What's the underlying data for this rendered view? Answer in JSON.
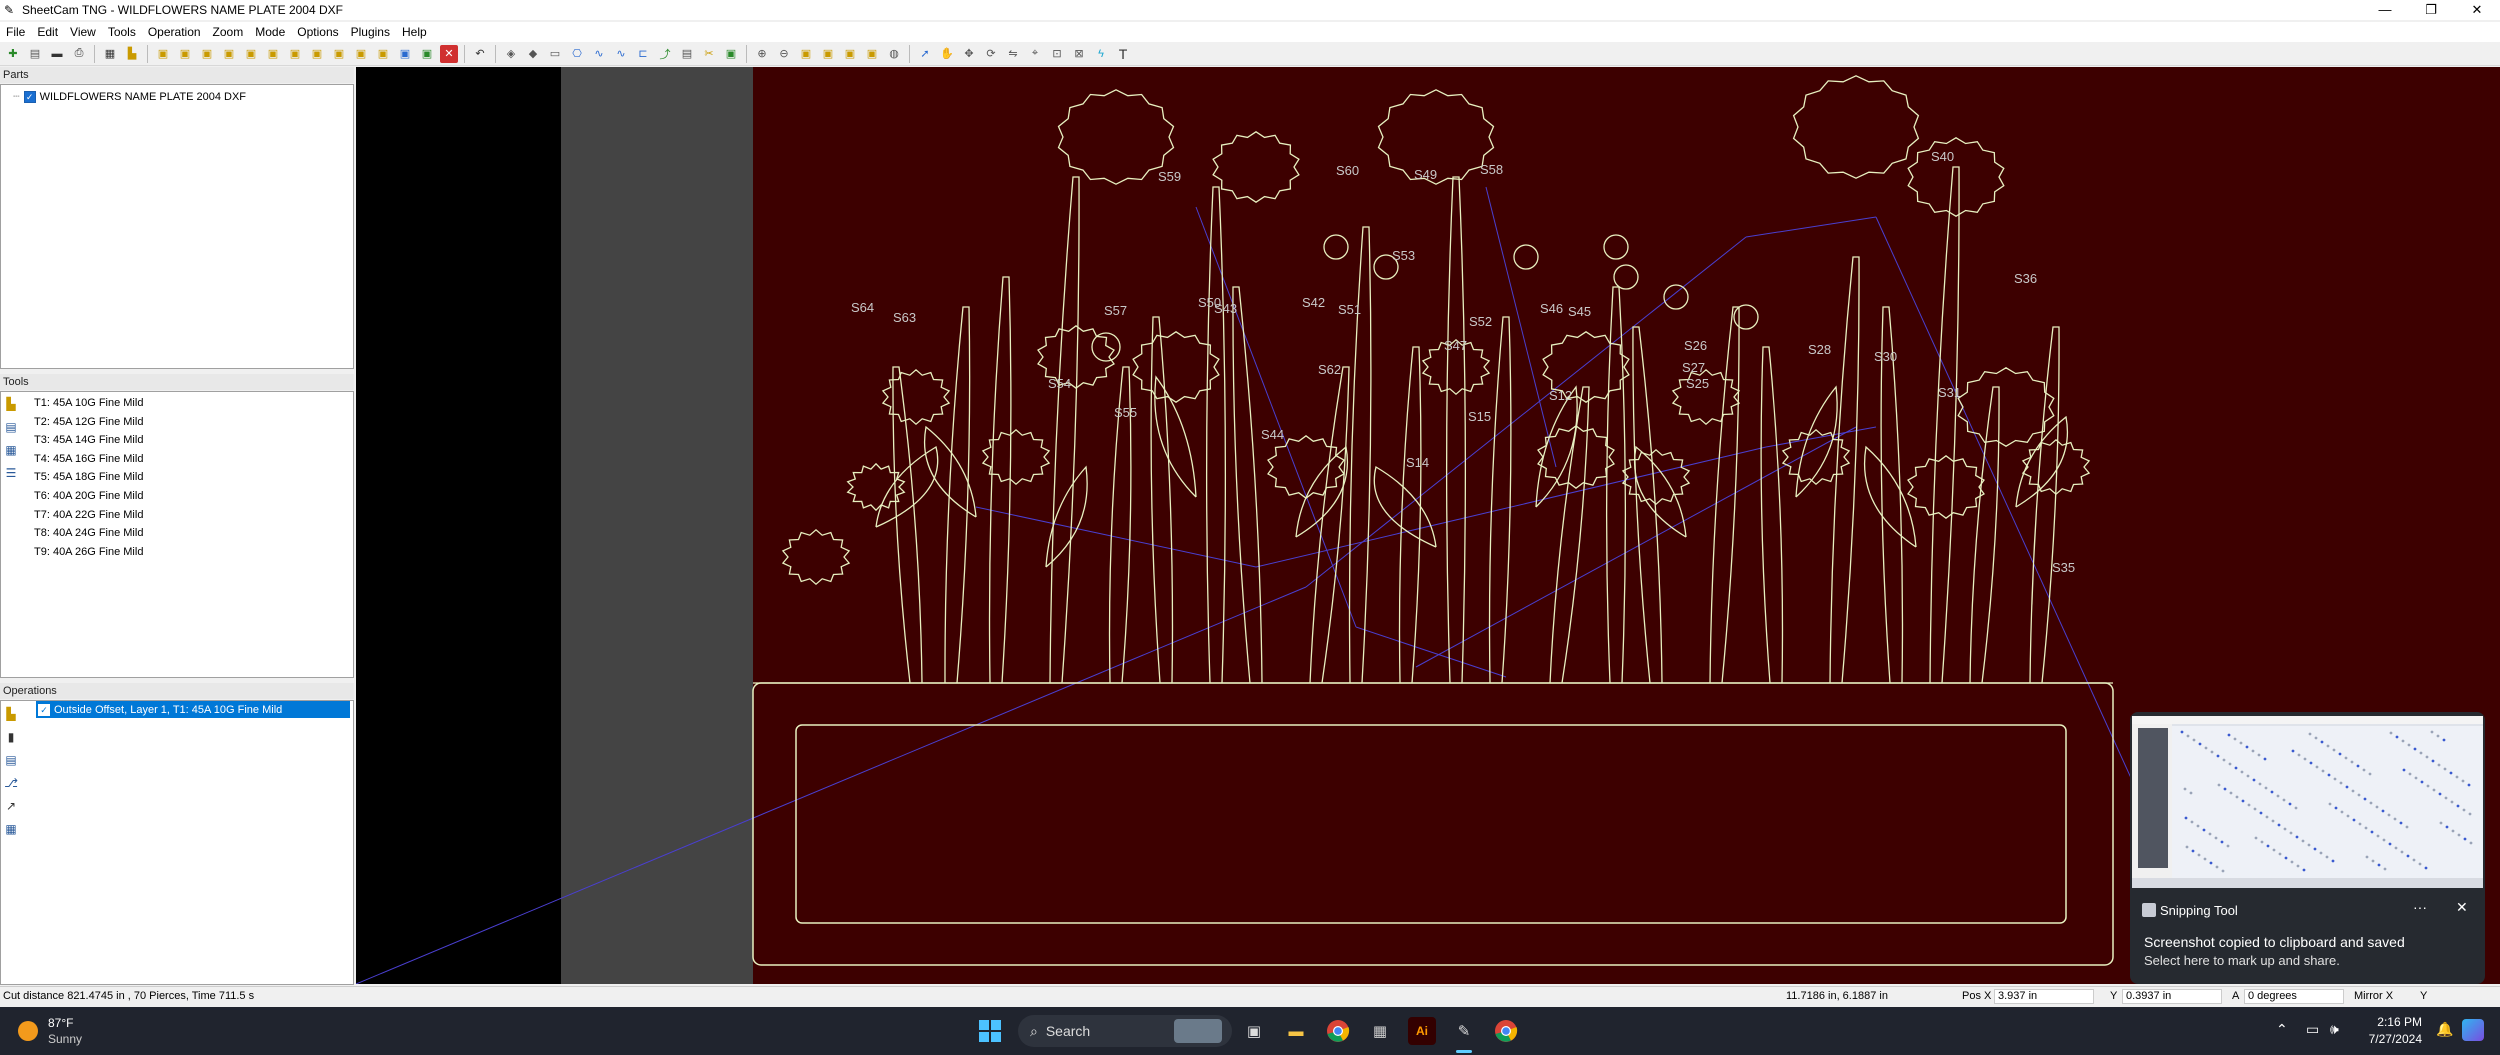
{
  "window": {
    "title": "SheetCam TNG - WILDFLOWERS NAME PLATE 2004 DXF",
    "controls": [
      "—",
      "❐",
      "✕"
    ]
  },
  "menu": [
    "File",
    "Edit",
    "View",
    "Tools",
    "Operation",
    "Zoom",
    "Mode",
    "Options",
    "Plugins",
    "Help"
  ],
  "panels": {
    "parts": {
      "header": "Parts",
      "items": [
        {
          "label": "WILDFLOWERS NAME PLATE 2004 DXF",
          "checked": true
        }
      ]
    },
    "tools": {
      "header": "Tools",
      "items": [
        "T1: 45A 10G Fine Mild",
        "T2: 45A 12G Fine Mild",
        "T3: 45A 14G Fine Mild",
        "T4: 45A 16G Fine Mild",
        "T5: 45A 18G Fine Mild",
        "T6: 40A 20G Fine Mild",
        "T7: 40A 22G Fine Mild",
        "T8: 40A 24G Fine Mild",
        "T9: 40A 26G Fine Mild"
      ]
    },
    "operations": {
      "header": "Operations",
      "items": [
        {
          "label": "Outside Offset, Layer 1, T1: 45A 10G Fine Mild",
          "checked": true,
          "selected": true
        }
      ]
    }
  },
  "viewport": {
    "background": "#3d0000",
    "outline_color": "#e8f0c0",
    "rapid_color": "#4a3fd0",
    "labels": [
      "S60",
      "S59",
      "S58",
      "S49",
      "S40",
      "S36",
      "S64",
      "S63",
      "S57",
      "S50",
      "S42",
      "S43",
      "S51",
      "S53",
      "S52",
      "S46",
      "S47",
      "S45",
      "S55",
      "S54",
      "S44",
      "S62",
      "S15",
      "S12",
      "S27",
      "S26",
      "S25",
      "S28",
      "S30",
      "S31",
      "S35",
      "S14"
    ]
  },
  "status": {
    "summary": "Cut distance 821.4745 in , 70 Pierces, Time 711.5 s",
    "cursor": "11.7186 in, 6.1887 in",
    "pos_x_label": "Pos X",
    "pos_x_value": "3.937 in",
    "y_label": "Y",
    "y_value": "0.3937 in",
    "angle_label": "A",
    "angle_value": "0 degrees",
    "mirror": "Mirror X",
    "mirror_y": "Y"
  },
  "toast": {
    "app": "Snipping Tool",
    "message": "Screenshot copied to clipboard and saved",
    "sub": "Select here to mark up and share.",
    "more": "···",
    "close": "✕"
  },
  "taskbar": {
    "weather_temp": "87°F",
    "weather_desc": "Sunny",
    "search": "Search",
    "time": "2:16 PM",
    "date": "7/27/2024"
  }
}
